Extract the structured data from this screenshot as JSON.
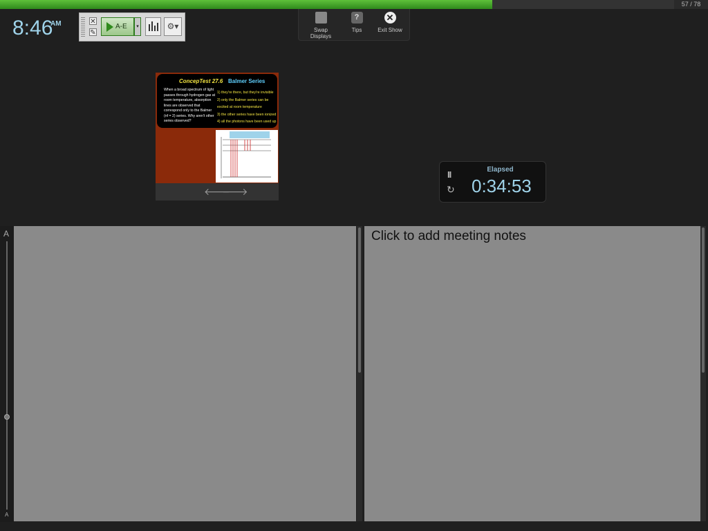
{
  "progress": {
    "fraction": 0.73,
    "counter_text": "57 / 78"
  },
  "clock": {
    "time": "8:46",
    "ampm": "AM"
  },
  "poll_toolbar": {
    "start_label": "A-E",
    "dropdown_icon": "▾",
    "settings_icon": "⚙▾",
    "close_icon": "✕",
    "edit_icon": "✎"
  },
  "top_toolbar": {
    "swap_label": "Swap Displays",
    "tips_label": "Tips",
    "tips_icon": "?",
    "exit_label": "Exit Show",
    "exit_icon": "✕"
  },
  "slide": {
    "title": "ConcepTest 27.6",
    "subtitle": "Balmer Series",
    "question": "When a broad spectrum of light passes through hydrogen gas at room temperature, absorption lines are observed that correspond only to the Balmer (nf = 2) series. Why aren't other series observed?",
    "answers": [
      "1) they're there, but they're invisible",
      "2) only the Balmer series can be excited at room temperature",
      "3) the other series have been ionized",
      "4) all the photons have been used up"
    ],
    "prev_icon": "🡐",
    "next_icon": "🡒"
  },
  "timer": {
    "label": "Elapsed",
    "value": "0:34:53",
    "pause_icon": "II",
    "reset_icon": "↻"
  },
  "font_slider": {
    "large": "A",
    "small": "A"
  },
  "meeting_notes": {
    "placeholder": "Click to add meeting notes"
  },
  "colors": {
    "accent": "#9fd3ea",
    "progress": "#3fa12a",
    "notes_bg": "#8a8a8a"
  }
}
